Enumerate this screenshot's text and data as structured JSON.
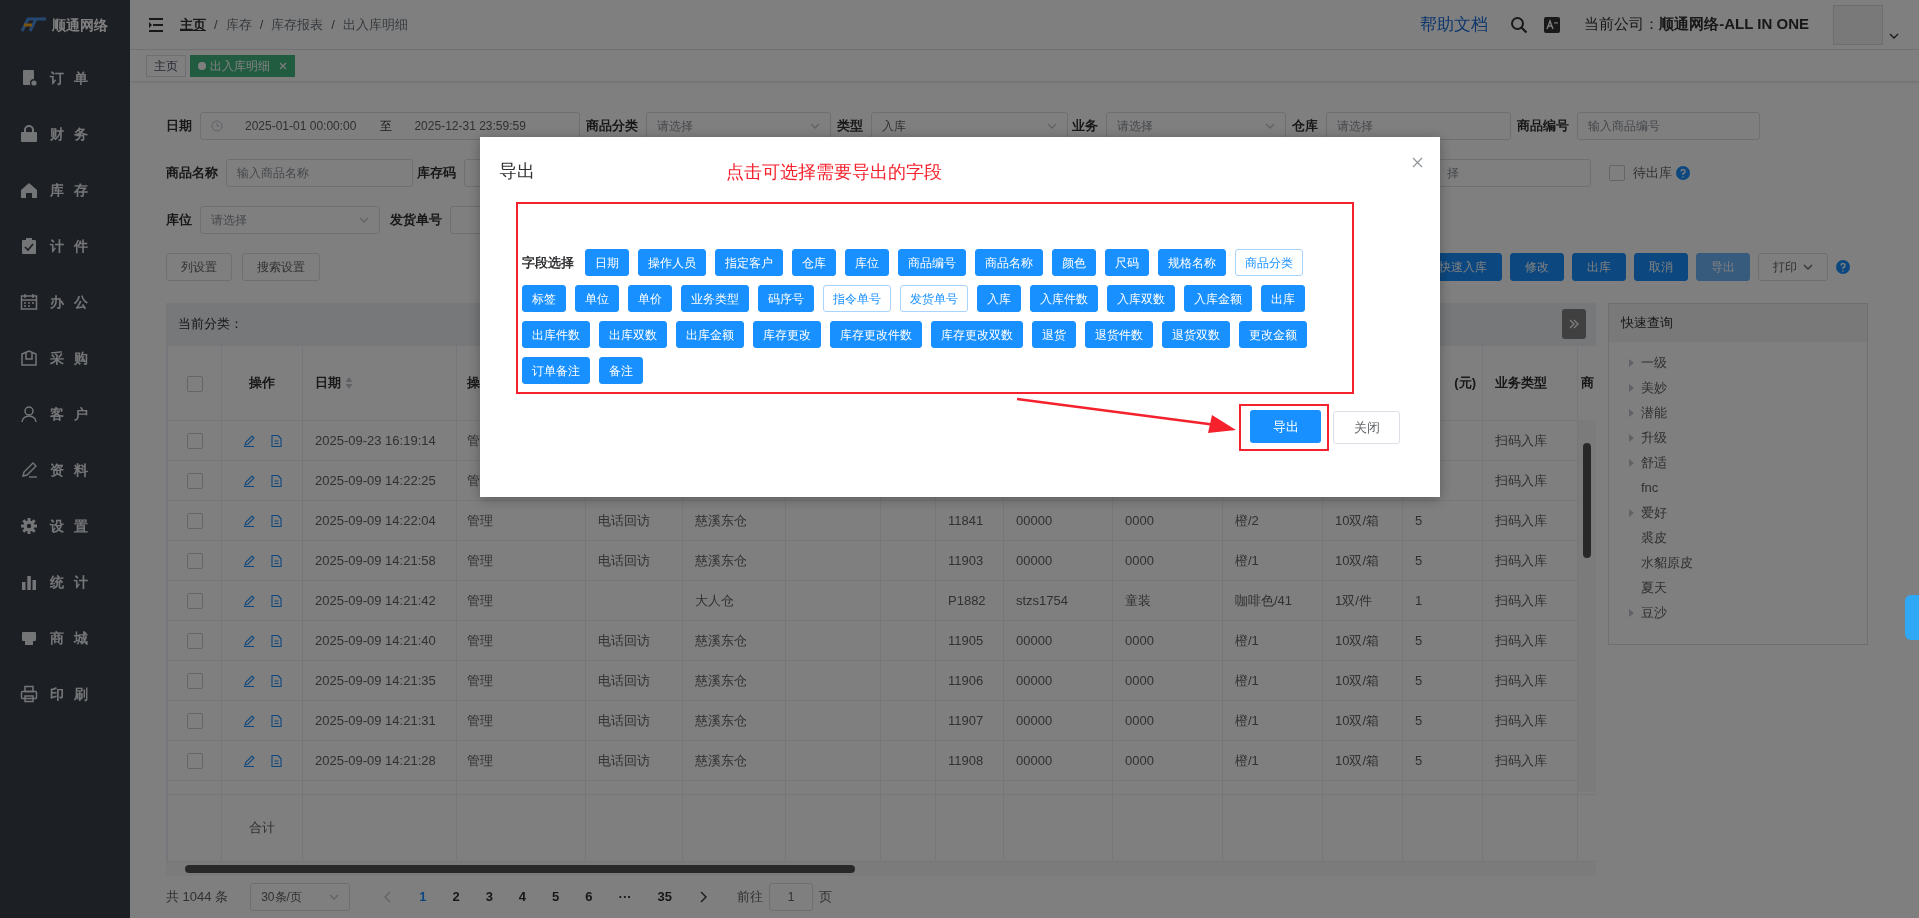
{
  "sidebar": {
    "logo": "顺通网络",
    "items": [
      {
        "label": "订单"
      },
      {
        "label": "财务"
      },
      {
        "label": "库存"
      },
      {
        "label": "计件"
      },
      {
        "label": "办公"
      },
      {
        "label": "采购"
      },
      {
        "label": "客户"
      },
      {
        "label": "资料"
      },
      {
        "label": "设置"
      },
      {
        "label": "统计"
      },
      {
        "label": "商城"
      },
      {
        "label": "印刷"
      }
    ]
  },
  "topbar": {
    "breadcrumb": [
      "主页",
      "库存",
      "库存报表",
      "出入库明细"
    ],
    "separator": "/",
    "help_link": "帮助文档",
    "company_label": "当前公司：",
    "company_name": "顺通网络-ALL IN ONE"
  },
  "tabs": [
    {
      "label": "主页",
      "selected": false
    },
    {
      "label": "出入库明细",
      "selected": true
    }
  ],
  "filters": [
    [
      {
        "kind": "daterange",
        "label": "日期",
        "start": "2025-01-01 00:00:00",
        "separator": "至",
        "end": "2025-12-31 23:59:59"
      },
      {
        "kind": "select",
        "label": "商品分类",
        "placeholder": "请选择"
      },
      {
        "kind": "select",
        "label": "类型",
        "value": "入库"
      },
      {
        "kind": "select",
        "label": "业务",
        "placeholder": "请选择"
      },
      {
        "kind": "input",
        "label": "仓库",
        "placeholder": "请选择"
      },
      {
        "kind": "input",
        "label": "商品编号",
        "placeholder": "输入商品编号"
      }
    ],
    [
      {
        "kind": "input",
        "label": "商品名称",
        "placeholder": "输入商品名称"
      },
      {
        "kind": "input",
        "label": "库存码"
      },
      {
        "kind": "input",
        "placeholder": "择"
      },
      {
        "kind": "checkbox",
        "label": "待出库",
        "checked": false
      }
    ],
    [
      {
        "kind": "select",
        "label": "库位",
        "placeholder": "请选择"
      },
      {
        "kind": "input",
        "label": "发货单号"
      }
    ]
  ],
  "toolbar": {
    "left": [
      "列设置",
      "搜索设置"
    ],
    "right": [
      {
        "label": "快速入库",
        "kind": "primary"
      },
      {
        "label": "修改",
        "kind": "primary"
      },
      {
        "label": "出库",
        "kind": "primary"
      },
      {
        "label": "取消",
        "kind": "primary"
      },
      {
        "label": "导出",
        "kind": "light"
      },
      {
        "label": "打印",
        "kind": "dropdown"
      }
    ]
  },
  "table": {
    "panel_title": "当前分类：",
    "columns": [
      {
        "kind": "check",
        "checked": false
      },
      {
        "label": "操作"
      },
      {
        "label": "日期",
        "kind": "sort"
      },
      {
        "label": "操"
      },
      {},
      {},
      {},
      {},
      {},
      {},
      {},
      {},
      {},
      {
        "label": "(元)"
      },
      {
        "label": "业务类型"
      },
      {
        "label": "商"
      }
    ],
    "rows": [
      {
        "checked": false,
        "date": "2025-09-23 16:19:14",
        "cells": [
          "管",
          null,
          null,
          null,
          null,
          null,
          null,
          null,
          null,
          null,
          null,
          "扫码入库"
        ]
      },
      {
        "checked": false,
        "date": "2025-09-09 14:22:25",
        "cells": [
          "管",
          null,
          null,
          null,
          null,
          null,
          null,
          null,
          null,
          null,
          null,
          "扫码入库"
        ]
      },
      {
        "checked": false,
        "date": "2025-09-09 14:22:04",
        "cells": [
          "管理",
          "电话回访",
          "慈溪东仓",
          null,
          null,
          "11841",
          "00000",
          "0000",
          "橙/2",
          "10双/箱",
          "5",
          "扫码入库"
        ]
      },
      {
        "checked": false,
        "date": "2025-09-09 14:21:58",
        "cells": [
          "管理",
          "电话回访",
          "慈溪东仓",
          null,
          null,
          "11903",
          "00000",
          "0000",
          "橙/1",
          "10双/箱",
          "5",
          "扫码入库"
        ]
      },
      {
        "checked": false,
        "date": "2025-09-09 14:21:42",
        "cells": [
          "管理",
          null,
          "大人仓",
          null,
          null,
          "P1882",
          "stzs1754",
          "童装",
          "咖啡色/41",
          "1双/件",
          "1",
          "扫码入库"
        ]
      },
      {
        "checked": false,
        "date": "2025-09-09 14:21:40",
        "cells": [
          "管理",
          "电话回访",
          "慈溪东仓",
          null,
          null,
          "11905",
          "00000",
          "0000",
          "橙/1",
          "10双/箱",
          "5",
          "扫码入库"
        ]
      },
      {
        "checked": false,
        "date": "2025-09-09 14:21:35",
        "cells": [
          "管理",
          "电话回访",
          "慈溪东仓",
          null,
          null,
          "11906",
          "00000",
          "0000",
          "橙/1",
          "10双/箱",
          "5",
          "扫码入库"
        ]
      },
      {
        "checked": false,
        "date": "2025-09-09 14:21:31",
        "cells": [
          "管理",
          "电话回访",
          "慈溪东仓",
          null,
          null,
          "11907",
          "00000",
          "0000",
          "橙/1",
          "10双/箱",
          "5",
          "扫码入库"
        ]
      },
      {
        "checked": false,
        "date": "2025-09-09 14:21:28",
        "cells": [
          "管理",
          "电话回访",
          "慈溪东仓",
          null,
          null,
          "11908",
          "00000",
          "0000",
          "橙/1",
          "10双/箱",
          "5",
          "扫码入库"
        ]
      }
    ],
    "footer_label": "合计"
  },
  "pagination": {
    "total": "共 1044 条",
    "page_size": "30条/页",
    "pages": [
      {
        "label": "1",
        "selected": true
      },
      {
        "label": "2",
        "selected": false
      },
      {
        "label": "3",
        "selected": false
      },
      {
        "label": "4",
        "selected": false
      },
      {
        "label": "5",
        "selected": false
      },
      {
        "label": "6",
        "selected": false
      },
      {
        "label": "···",
        "selected": false
      },
      {
        "label": "35",
        "selected": false
      }
    ],
    "goto_label": "前往",
    "goto_value": "1",
    "goto_suffix": "页"
  },
  "quick_panel": {
    "title": "快速查询",
    "items": [
      {
        "label": "一级",
        "expandable": true
      },
      {
        "label": "美妙",
        "expandable": true
      },
      {
        "label": "潜能",
        "expandable": true
      },
      {
        "label": "升级",
        "expandable": true
      },
      {
        "label": "舒适",
        "expandable": true
      },
      {
        "label": "fnc",
        "expandable": false
      },
      {
        "label": "爱好",
        "expandable": true
      },
      {
        "label": "裘皮",
        "expandable": false
      },
      {
        "label": "水貂原皮",
        "expandable": false
      },
      {
        "label": "夏天",
        "expandable": false
      },
      {
        "label": "豆沙",
        "expandable": true
      }
    ]
  },
  "export_dialog": {
    "title": "导出",
    "annotation": "点击可选择需要导出的字段",
    "field_label": "字段选择",
    "fields": [
      {
        "label": "日期",
        "selected": true
      },
      {
        "label": "操作人员",
        "selected": true
      },
      {
        "label": "指定客户",
        "selected": true
      },
      {
        "label": "仓库",
        "selected": true
      },
      {
        "label": "库位",
        "selected": true
      },
      {
        "label": "商品编号",
        "selected": true
      },
      {
        "label": "商品名称",
        "selected": true
      },
      {
        "label": "颜色",
        "selected": true
      },
      {
        "label": "尺码",
        "selected": true
      },
      {
        "label": "规格名称",
        "selected": true
      },
      {
        "label": "商品分类",
        "selected": false
      },
      {
        "label": "标签",
        "selected": true
      },
      {
        "label": "单位",
        "selected": true
      },
      {
        "label": "单价",
        "selected": true
      },
      {
        "label": "业务类型",
        "selected": true
      },
      {
        "label": "码序号",
        "selected": true
      },
      {
        "label": "指令单号",
        "selected": false
      },
      {
        "label": "发货单号",
        "selected": false
      },
      {
        "label": "入库",
        "selected": true
      },
      {
        "label": "入库件数",
        "selected": true
      },
      {
        "label": "入库双数",
        "selected": true
      },
      {
        "label": "入库金额",
        "selected": true
      },
      {
        "label": "出库",
        "selected": true
      },
      {
        "label": "出库件数",
        "selected": true
      },
      {
        "label": "出库双数",
        "selected": true
      },
      {
        "label": "出库金额",
        "selected": true
      },
      {
        "label": "库存更改",
        "selected": true
      },
      {
        "label": "库存更改件数",
        "selected": true
      },
      {
        "label": "库存更改双数",
        "selected": true
      },
      {
        "label": "退货",
        "selected": true
      },
      {
        "label": "退货件数",
        "selected": true
      },
      {
        "label": "退货双数",
        "selected": true
      },
      {
        "label": "更改金额",
        "selected": true
      },
      {
        "label": "订单备注",
        "selected": true
      },
      {
        "label": "备注",
        "selected": true
      }
    ],
    "confirm": "导出",
    "cancel": "关闭"
  }
}
